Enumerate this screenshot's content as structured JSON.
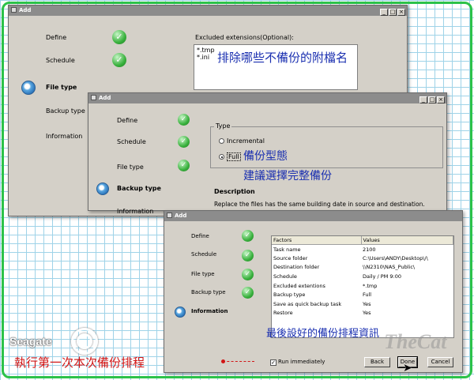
{
  "dialogs": [
    {
      "title": "Add",
      "steps": [
        "Define",
        "Schedule",
        "File type",
        "Backup type",
        "Information"
      ],
      "excluded_label": "Excluded extensions(Optional):",
      "excluded_values": [
        "*.tmp",
        "*.ini"
      ],
      "annotation": "排除哪些不備份的附檔名"
    },
    {
      "title": "Add",
      "steps": [
        "Define",
        "Schedule",
        "File type",
        "Backup type",
        "Information"
      ],
      "type_group": "Type",
      "option_incremental": "Incremental",
      "option_full": "Full",
      "description_title": "Description",
      "description_text": "Replace the files has the same building date in source and destination.",
      "annotation_line1": "備份型態",
      "annotation_line2": "建議選擇完整備份"
    },
    {
      "title": "Add",
      "steps": [
        "Define",
        "Schedule",
        "File type",
        "Backup type",
        "Information"
      ],
      "table_headers": [
        "Factors",
        "Values"
      ],
      "rows": [
        [
          "Task name",
          "2100"
        ],
        [
          "Source folder",
          "C:\\Users\\ANDY\\Desktop\\/\\"
        ],
        [
          "Destination folder",
          "\\\\N2310\\NAS_Public\\"
        ],
        [
          "Schedule",
          "Daily  /  PM 9:00"
        ],
        [
          "Excluded extentions",
          "*.tmp"
        ],
        [
          "Backup type",
          "Full"
        ],
        [
          "Save as quick backup task",
          "Yes"
        ],
        [
          "Restore",
          "Yes"
        ]
      ],
      "annotation": "最後設好的備份排程資訊",
      "run_immediately": "Run immediately",
      "buttons": {
        "back": "Back",
        "done": "Done",
        "cancel": "Cancel"
      }
    }
  ],
  "bottom_annotation": "執行第一次本次備份排程",
  "logo": "Seagate",
  "watermark": "TheCat",
  "colors": {
    "check_green": "#39b13d",
    "annotation_blue": "#1a2fb0",
    "annotation_red": "#d11616",
    "frame_green": "#2cc24a",
    "grid_blue": "#9fd3e8"
  }
}
